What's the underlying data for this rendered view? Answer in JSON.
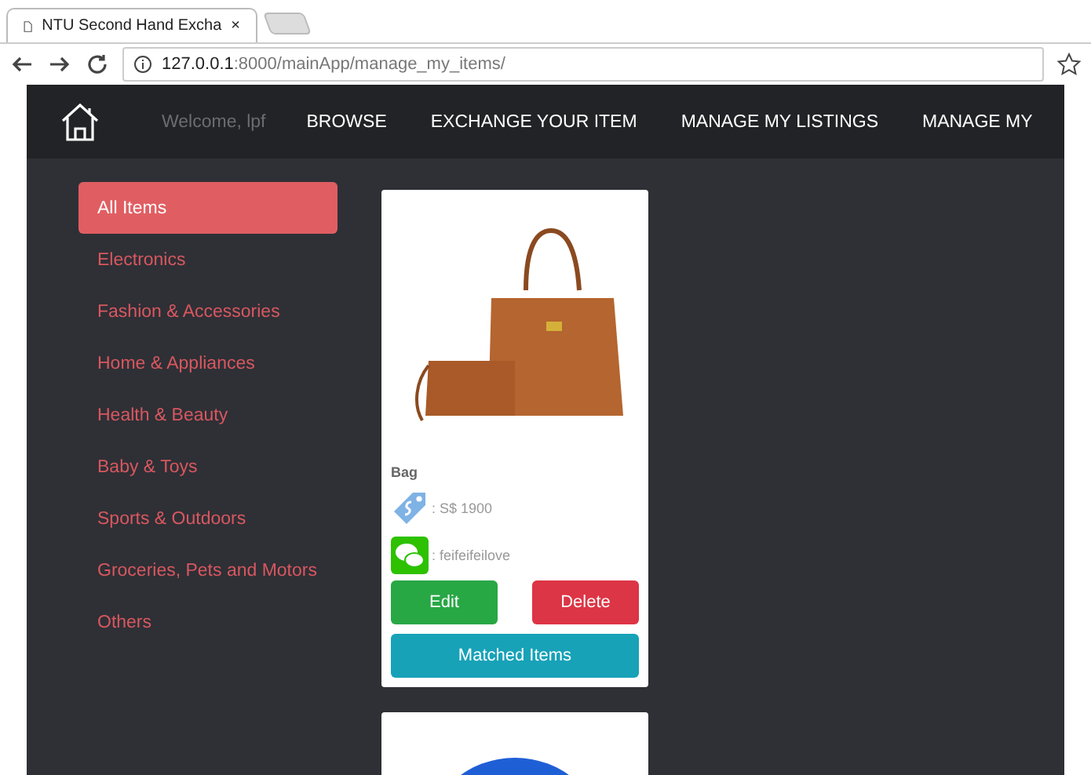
{
  "browser": {
    "tab_title": "NTU Second Hand Excha",
    "tab_close": "×",
    "url_host": "127.0.0.1",
    "url_path": ":8000/mainApp/manage_my_items/"
  },
  "navbar": {
    "welcome": "Welcome, lpf",
    "links": [
      "BROWSE",
      "EXCHANGE YOUR ITEM",
      "MANAGE MY LISTINGS",
      "MANAGE MY"
    ]
  },
  "sidebar": {
    "items": [
      {
        "label": "All Items",
        "selected": true
      },
      {
        "label": "Electronics",
        "selected": false
      },
      {
        "label": "Fashion & Accessories",
        "selected": false
      },
      {
        "label": "Home & Appliances",
        "selected": false
      },
      {
        "label": "Health & Beauty",
        "selected": false
      },
      {
        "label": "Baby & Toys",
        "selected": false
      },
      {
        "label": "Sports & Outdoors",
        "selected": false
      },
      {
        "label": "Groceries, Pets and Motors",
        "selected": false
      },
      {
        "label": "Others",
        "selected": false
      }
    ]
  },
  "items": [
    {
      "kind": "full",
      "name": "Bag",
      "price": ": S$ 1900",
      "contact": ": feifeifeilove",
      "buttons": [
        "Edit",
        "Delete",
        "Matched Items"
      ]
    },
    {
      "kind": "partial"
    }
  ]
}
